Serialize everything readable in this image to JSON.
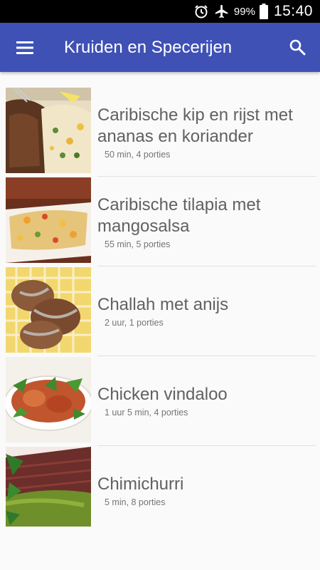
{
  "status_bar": {
    "battery": "99%",
    "time": "15:40",
    "icons": [
      "alarm-icon",
      "airplane-icon",
      "battery-icon"
    ]
  },
  "app_bar": {
    "title": "Kruiden en Specerijen",
    "menu_icon": "menu-icon",
    "search_icon": "search-icon",
    "color": "#3f51b5"
  },
  "recipes": [
    {
      "name": "Caribische kip en rijst met ananas en koriander",
      "meta": "50 min, 4 porties"
    },
    {
      "name": "Caribische tilapia met mangosalsa",
      "meta": "55 min, 5 porties"
    },
    {
      "name": "Challah met anijs",
      "meta": "2 uur, 1 porties"
    },
    {
      "name": "Chicken vindaloo",
      "meta": "1 uur 5 min, 4 porties"
    },
    {
      "name": "Chimichurri",
      "meta": "5 min, 8 porties"
    }
  ]
}
